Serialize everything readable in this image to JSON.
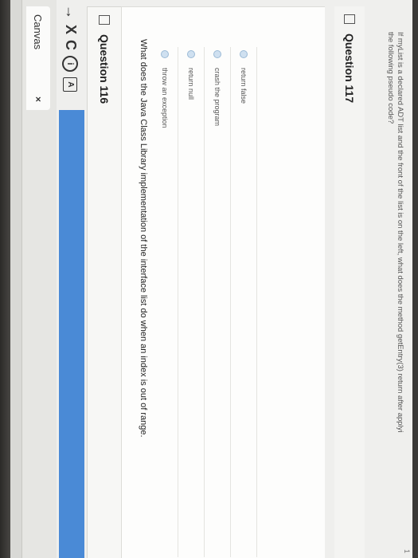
{
  "browser": {
    "tab_title": "Canvas",
    "tab_close": "×"
  },
  "toolbar": {
    "back": "→",
    "stop": "X",
    "reload": "C",
    "info": "i",
    "reader": "A"
  },
  "question_116": {
    "title": "Question 116",
    "text": "What does the Java Class Library implementation of the interface list do when an index is out of range.",
    "answers": [
      "return false",
      "crash the program",
      "return null",
      "throw an exception"
    ]
  },
  "question_117": {
    "title": "Question 117",
    "text_line1": "If myList is a declared ADT list and the front of the list is on the left, what does the method getEntry(3) return after applyi",
    "text_line2": "the following pseudo code?",
    "page_marker": "1"
  }
}
